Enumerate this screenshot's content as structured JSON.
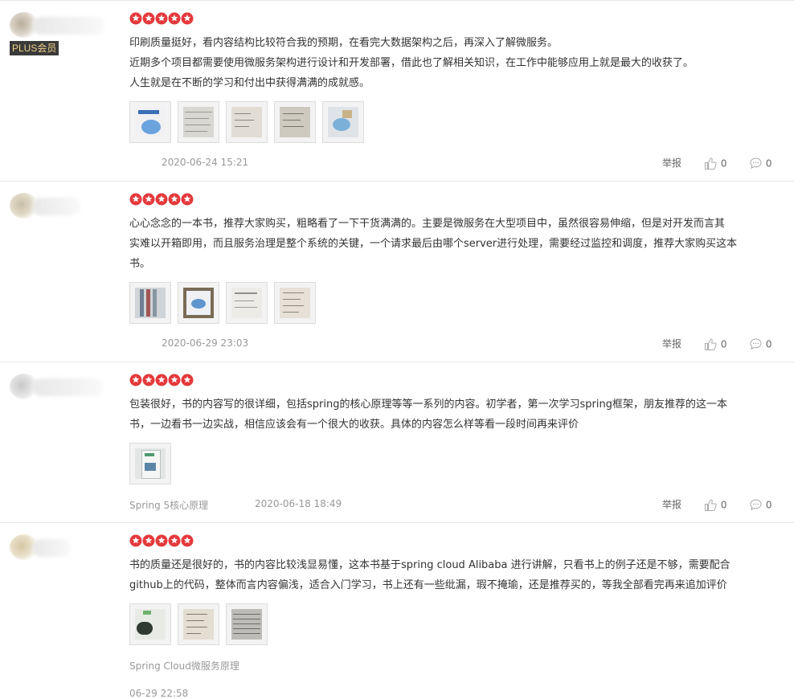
{
  "colors": {
    "star": "#e4393c",
    "plus_bg": "#3a3a3a",
    "plus_text": "#f2d48a"
  },
  "reviews": [
    {
      "badge": "PLUS会员",
      "rating": 5,
      "lines": [
        "印刷质量挺好，看内容结构比较符合我的预期，在看完大数据架构之后，再深入了解微服务。",
        "近期多个项目都需要使用微服务架构进行设计和开发部署，借此也了解相关知识，在工作中能够应用上就是最大的收获了。",
        "人生就是在不断的学习和付出中获得满满的成就感。"
      ],
      "image_count": 5,
      "product": "",
      "date": "2020-06-24 15:21",
      "report": "举报",
      "likes": "0",
      "comments": "0"
    },
    {
      "badge": "",
      "rating": 5,
      "lines": [
        "心心念念的一本书，推荐大家购买，粗略看了一下干货满满的。主要是微服务在大型项目中，虽然很容易伸缩，但是对开发而言其",
        "实难以开箱即用，而且服务治理是整个系统的关键，一个请求最后由哪个server进行处理，需要经过监控和调度，推荐大家购买这本",
        "书。"
      ],
      "image_count": 4,
      "product": "",
      "date": "2020-06-29 23:03",
      "report": "举报",
      "likes": "0",
      "comments": "0"
    },
    {
      "badge": "",
      "rating": 5,
      "lines": [
        "包装很好，书的内容写的很详细，包括spring的核心原理等等一系列的内容。初学者，第一次学习spring框架，朋友推荐的这一本",
        "书，一边看书一边实战，相信应该会有一个很大的收获。具体的内容怎么样等看一段时间再来评价"
      ],
      "image_count": 1,
      "product": "Spring 5核心原理",
      "date": "2020-06-18 18:49",
      "report": "举报",
      "likes": "0",
      "comments": "0"
    },
    {
      "badge": "",
      "rating": 5,
      "lines": [
        "书的质量还是很好的，书的内容比较浅显易懂，这本书基于spring cloud Alibaba 进行讲解，只看书上的例子还是不够，需要配合",
        "github上的代码，整体而言内容偏浅，适合入门学习，书上还有一些纰漏，瑕不掩瑜，还是推荐买的，等我全部看完再来追加评价"
      ],
      "image_count": 3,
      "product": "Spring Cloud微服务原理",
      "date": "06-29 22:58",
      "report": "",
      "likes": "",
      "comments": ""
    }
  ]
}
